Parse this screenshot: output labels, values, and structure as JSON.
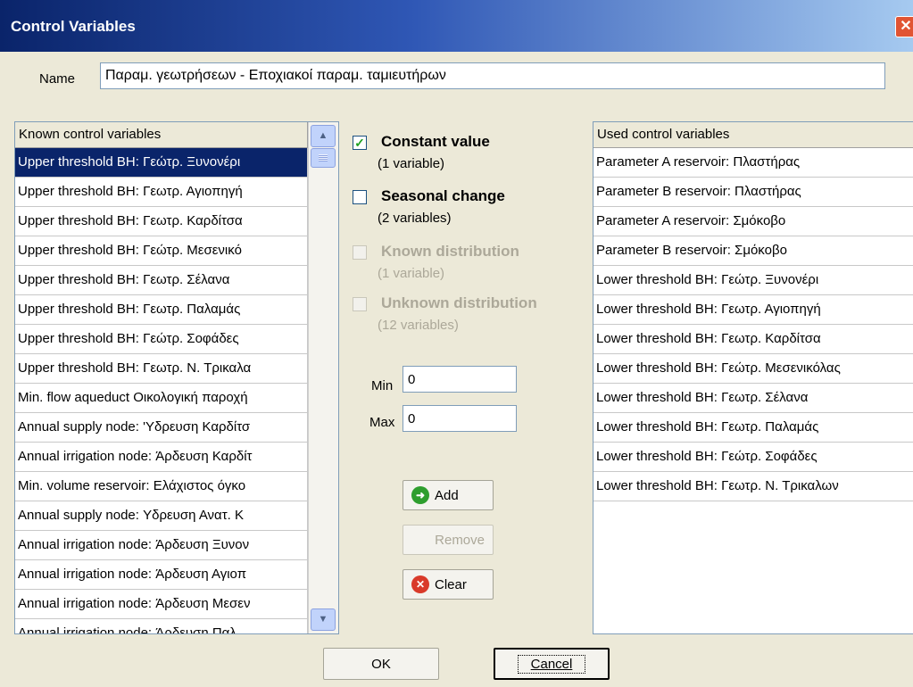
{
  "window": {
    "title": "Control Variables",
    "close_glyph": "✕"
  },
  "name_field": {
    "label": "Name",
    "value": "Παραμ. γεωτρήσεων - Εποχιακοί παραμ. ταμιευτήρων"
  },
  "known_list": {
    "header": "Known control variables",
    "selected_index": 0,
    "items": [
      "Upper threshold BH: Γεώτρ. Ξυνονέρι",
      "Upper threshold BH: Γεωτρ. Αγιοπηγή",
      "Upper threshold BH: Γεωτρ. Καρδίτσα",
      "Upper threshold BH: Γεώτρ. Μεσενικό",
      "Upper threshold BH: Γεωτρ. Σέλανα",
      "Upper threshold BH: Γεωτρ. Παλαμάς",
      "Upper threshold BH: Γεώτρ. Σοφάδες",
      "Upper threshold BH: Γεωτρ. Ν. Τρικαλα",
      "Min. flow aqueduct Οικολογική παροχή",
      "Annual supply node: 'Υδρευση Καρδίτσ",
      "Annual irrigation node: Άρδευση Καρδίτ",
      "Min. volume reservoir: Ελάχιστος όγκο",
      "Annual supply node: Υδρευση Ανατ. Κ",
      "Annual irrigation node: Άρδευση Ξυνον",
      "Annual irrigation node: Άρδευση Αγιοπ",
      "Annual irrigation node: Άρδευση Μεσεν",
      "Annual irrigation node: Άρδευση Παλ"
    ]
  },
  "scrollbar": {
    "up_glyph": "▲",
    "down_glyph": "▼"
  },
  "options": [
    {
      "title": "Constant value",
      "subtitle": "(1 variable)",
      "checked": true,
      "enabled": true
    },
    {
      "title": "Seasonal change",
      "subtitle": "(2 variables)",
      "checked": false,
      "enabled": true
    },
    {
      "title": "Known distribution",
      "subtitle": "(1 variable)",
      "checked": false,
      "enabled": false
    },
    {
      "title": "Unknown distribution",
      "subtitle": "(12 variables)",
      "checked": false,
      "enabled": false
    }
  ],
  "check_glyph": "✓",
  "min": {
    "label": "Min",
    "value": "0"
  },
  "max": {
    "label": "Max",
    "value": "0"
  },
  "buttons": {
    "add": "Add",
    "add_glyph": "➜",
    "remove": "Remove",
    "clear": "Clear",
    "clear_glyph": "✕",
    "ok": "OK",
    "cancel": "Cancel"
  },
  "used_list": {
    "header": "Used control variables",
    "items": [
      "Parameter A reservoir: Πλαστήρας",
      "Parameter B reservoir: Πλαστήρας",
      "Parameter A reservoir: Σμόκοβο",
      "Parameter B reservoir: Σμόκοβο",
      "Lower threshold BH: Γεώτρ. Ξυνονέρι",
      "Lower threshold BH: Γεωτρ. Αγιοπηγή",
      "Lower threshold BH: Γεωτρ. Καρδίτσα",
      "Lower threshold BH: Γεώτρ. Μεσενικόλας",
      "Lower threshold BH: Γεωτρ. Σέλανα",
      "Lower threshold BH: Γεωτρ. Παλαμάς",
      "Lower threshold BH: Γεώτρ. Σοφάδες",
      "Lower threshold BH: Γεωτρ. Ν. Τρικαλων"
    ]
  },
  "colors": {
    "title_gradient_start": "#0A246A",
    "title_gradient_end": "#A6CAF0",
    "selection": "#0A246A",
    "dialog_bg": "#ECE9D8",
    "add_icon": "#2E9E2E",
    "clear_icon": "#D93A2A",
    "disabled_text": "#ACA899"
  },
  "icons": {
    "add": "green-arrow-icon",
    "clear": "red-x-icon",
    "close": "close-icon"
  }
}
